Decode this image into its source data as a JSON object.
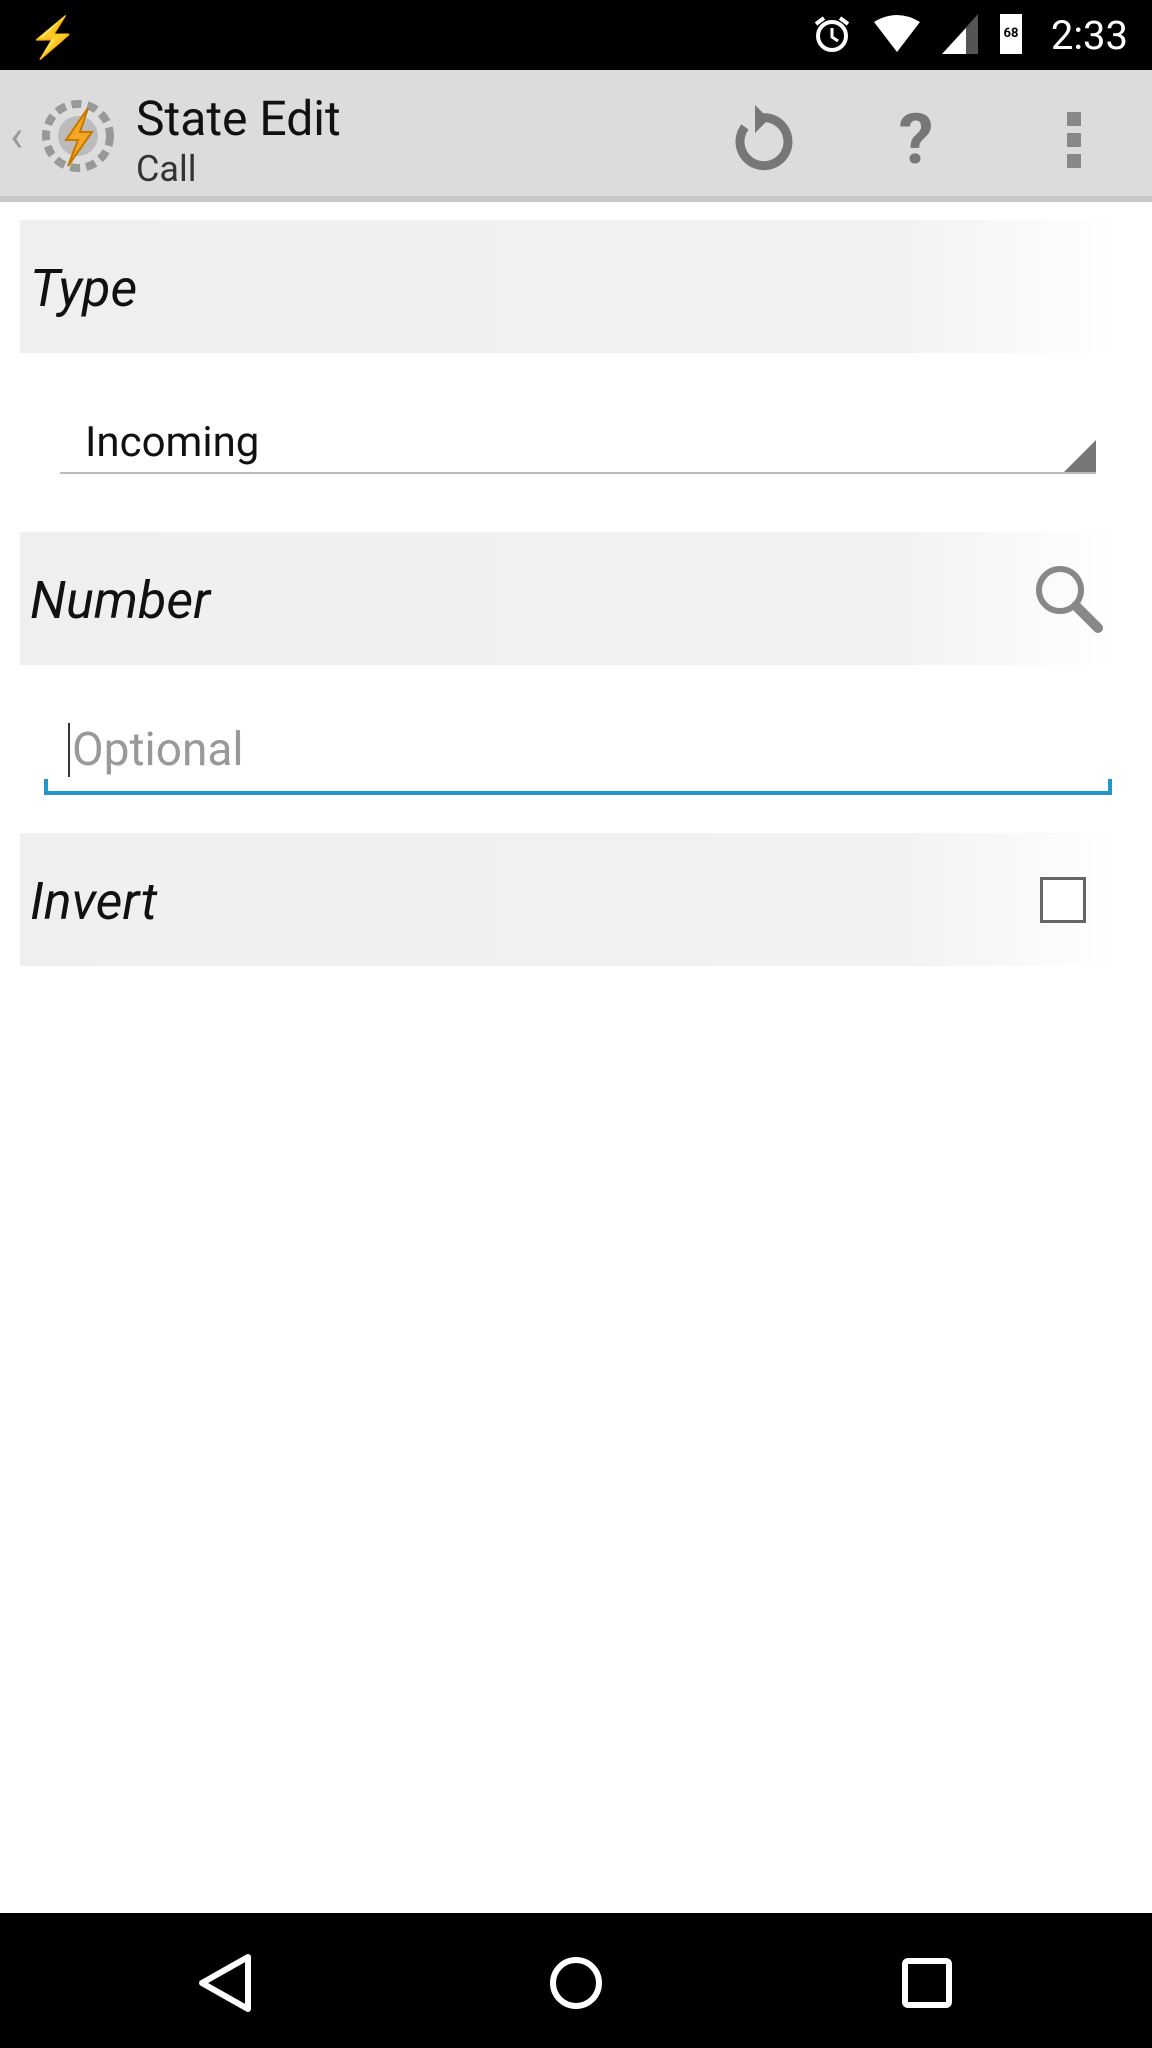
{
  "status_bar": {
    "time": "2:33",
    "battery_level": "68",
    "icons": [
      "flash-icon",
      "alarm-icon",
      "wifi-icon",
      "signal-icon",
      "battery-icon"
    ]
  },
  "action_bar": {
    "title": "State Edit",
    "subtitle": "Call",
    "actions": [
      "undo-icon",
      "help-icon",
      "overflow-menu-icon"
    ],
    "help_glyph": "?"
  },
  "sections": {
    "type": {
      "label": "Type",
      "selected": "Incoming"
    },
    "number": {
      "label": "Number",
      "placeholder": "Optional",
      "value": ""
    },
    "invert": {
      "label": "Invert",
      "checked": false
    }
  },
  "colors": {
    "accent": "#2196c8",
    "actionbar": "#dcdcdc"
  },
  "nav_bar": [
    "back-icon",
    "home-icon",
    "recents-icon"
  ]
}
